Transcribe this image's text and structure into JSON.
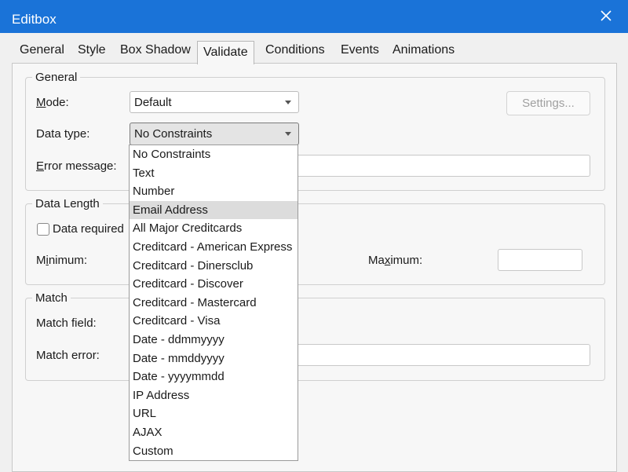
{
  "window": {
    "title": "Editbox",
    "close_icon": "close-icon"
  },
  "tabs": [
    {
      "label": "General"
    },
    {
      "label": "Style"
    },
    {
      "label": "Box Shadow"
    },
    {
      "label": "Validate",
      "active": true
    },
    {
      "label": "Conditions"
    },
    {
      "label": "Events"
    },
    {
      "label": "Animations"
    }
  ],
  "general": {
    "legend": "General",
    "mode_label": "Mode:",
    "mode_value": "Default",
    "settings_button": "Settings...",
    "data_type_label": "Data type:",
    "data_type_value": "No Constraints",
    "error_message_label": "Error message:"
  },
  "data_length": {
    "legend": "Data Length",
    "data_required_label": "Data required",
    "data_required_checked": false,
    "minimum_label": "Minimum:",
    "maximum_label": "Maximum:"
  },
  "match": {
    "legend": "Match",
    "match_field_label": "Match field:",
    "match_error_label": "Match error:"
  },
  "dropdown": {
    "highlighted": "Email Address",
    "options": [
      "No Constraints",
      "Text",
      "Number",
      "Email Address",
      "All Major Creditcards",
      "Creditcard - American Express",
      "Creditcard - Dinersclub",
      "Creditcard - Discover",
      "Creditcard - Mastercard",
      "Creditcard - Visa",
      "Date - ddmmyyyy",
      "Date - mmddyyyy",
      "Date - yyyymmdd",
      "IP Address",
      "URL",
      "AJAX",
      "Custom"
    ]
  }
}
